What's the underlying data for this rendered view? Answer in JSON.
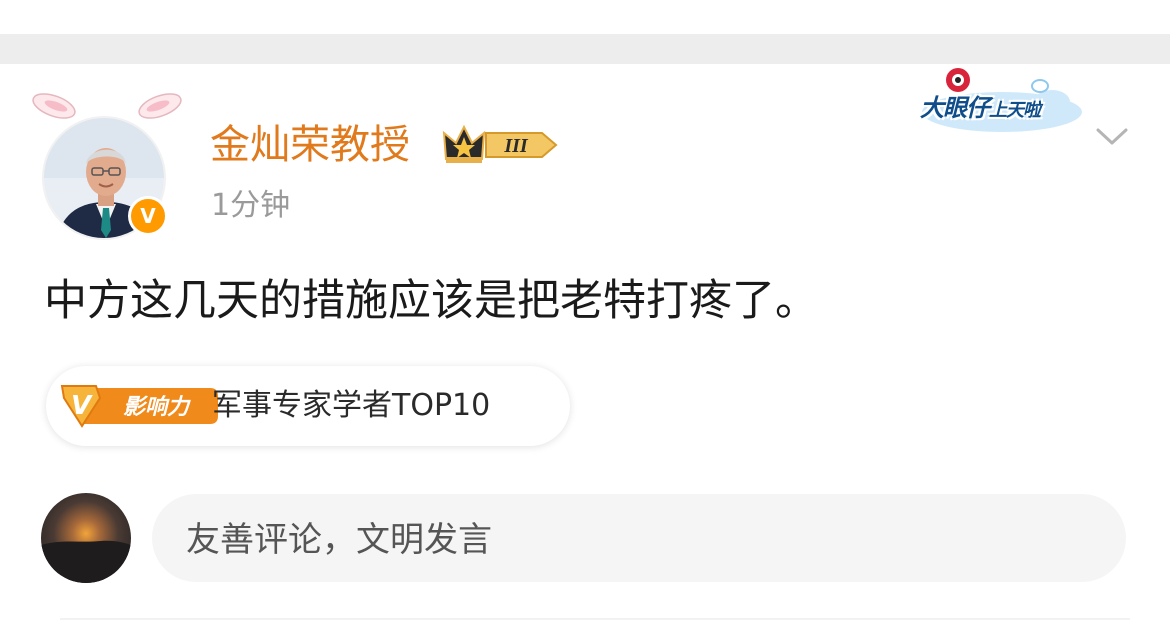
{
  "post": {
    "author": {
      "name": "金灿荣教授",
      "level_badge": "III",
      "verified_mark": "V",
      "avatar_icon": "avatar-icon"
    },
    "time": "1分钟",
    "content": "中方这几天的措施应该是把老特打疼了。",
    "influence": {
      "badge_text": "影响力",
      "badge_letter": "V",
      "label": "军事专家学者TOP10"
    },
    "sticker": {
      "main": "大眼仔",
      "small": "上天啦"
    }
  },
  "comment": {
    "placeholder": "友善评论，文明发言"
  },
  "colors": {
    "author_name": "#e07a1c",
    "verified_badge": "#ff9a00",
    "time_text": "#9a9a9a",
    "comment_box_bg": "#f5f5f5"
  }
}
